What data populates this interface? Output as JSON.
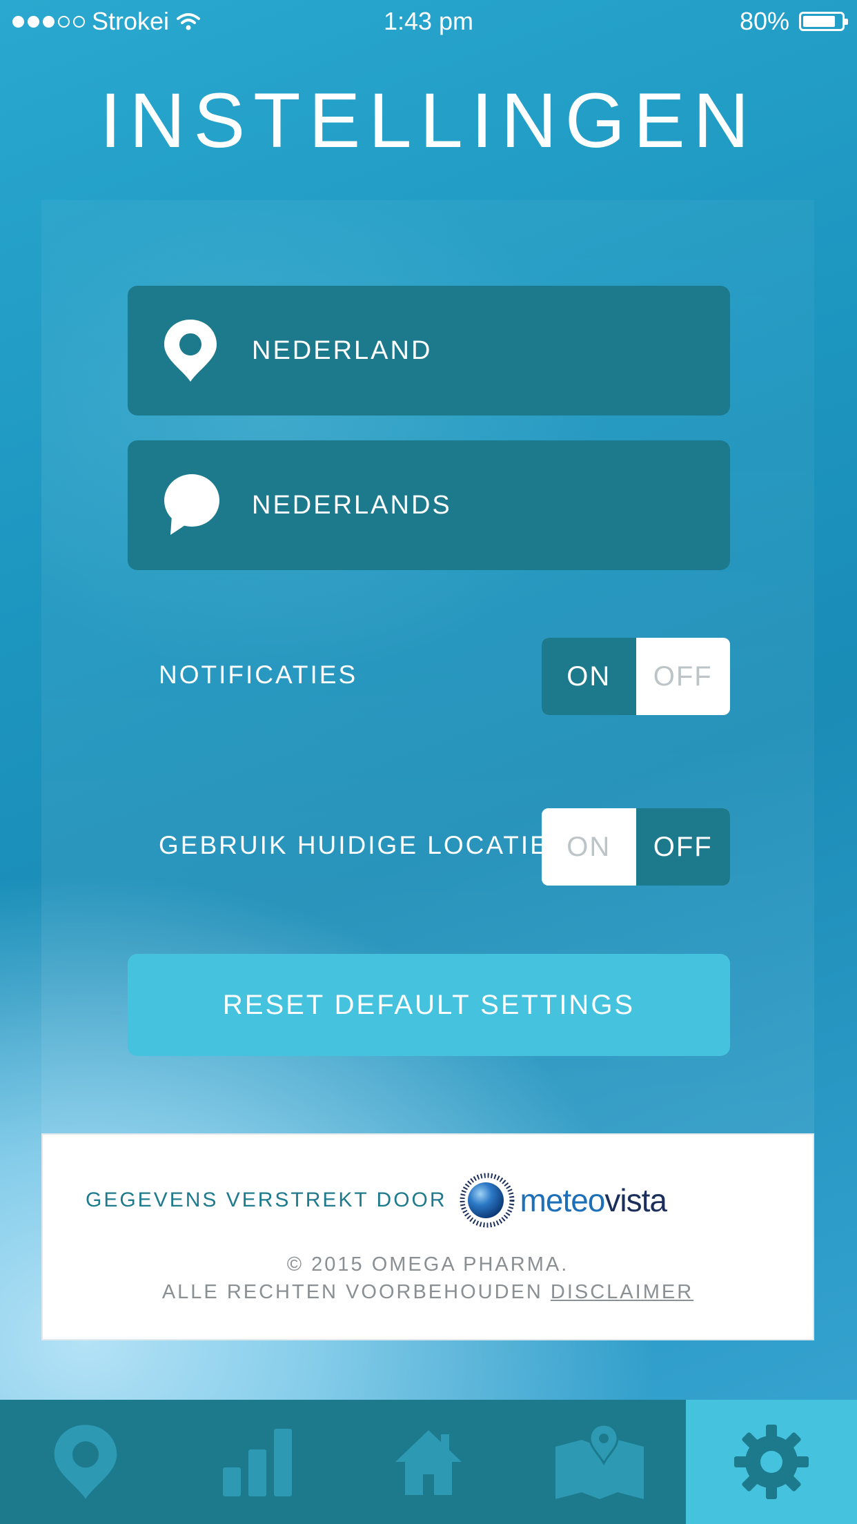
{
  "status_bar": {
    "carrier": "Strokei",
    "time": "1:43 pm",
    "battery": "80%",
    "signal_icon": "signal-dots-icon",
    "wifi_icon": "wifi-icon",
    "battery_icon": "battery-icon"
  },
  "page": {
    "title": "INSTELLINGEN"
  },
  "settings": {
    "country": {
      "label": "NEDERLAND",
      "icon": "location-pin-icon"
    },
    "language": {
      "label": "NEDERLANDS",
      "icon": "speech-bubble-icon"
    },
    "notifications": {
      "label": "NOTIFICATIES",
      "on": "ON",
      "off": "OFF",
      "selected": "ON"
    },
    "use_location": {
      "label": "GEBRUIK HUIDIGE LOCATIE",
      "on": "ON",
      "off": "OFF",
      "selected": "OFF"
    },
    "reset_button": "RESET DEFAULT SETTINGS"
  },
  "footer": {
    "provided_by": "GEGEVENS VERSTREKT DOOR",
    "logo_part1": "meteo",
    "logo_part2": "vista",
    "copyright": "© 2015 OMEGA PHARMA.",
    "rights": "ALLE RECHTEN VOORBEHOUDEN",
    "disclaimer": "DISCLAIMER"
  },
  "tabbar": {
    "tabs": [
      {
        "icon": "location-pin-icon",
        "active": false
      },
      {
        "icon": "bar-chart-icon",
        "active": false
      },
      {
        "icon": "home-icon",
        "active": false
      },
      {
        "icon": "map-icon",
        "active": false
      },
      {
        "icon": "gear-icon",
        "active": true
      }
    ]
  },
  "colors": {
    "row_bg": "#1c7a8c",
    "accent": "#45c2dd",
    "footer_text": "#1e7a8d",
    "logo_blue": "#1d4a8c"
  }
}
